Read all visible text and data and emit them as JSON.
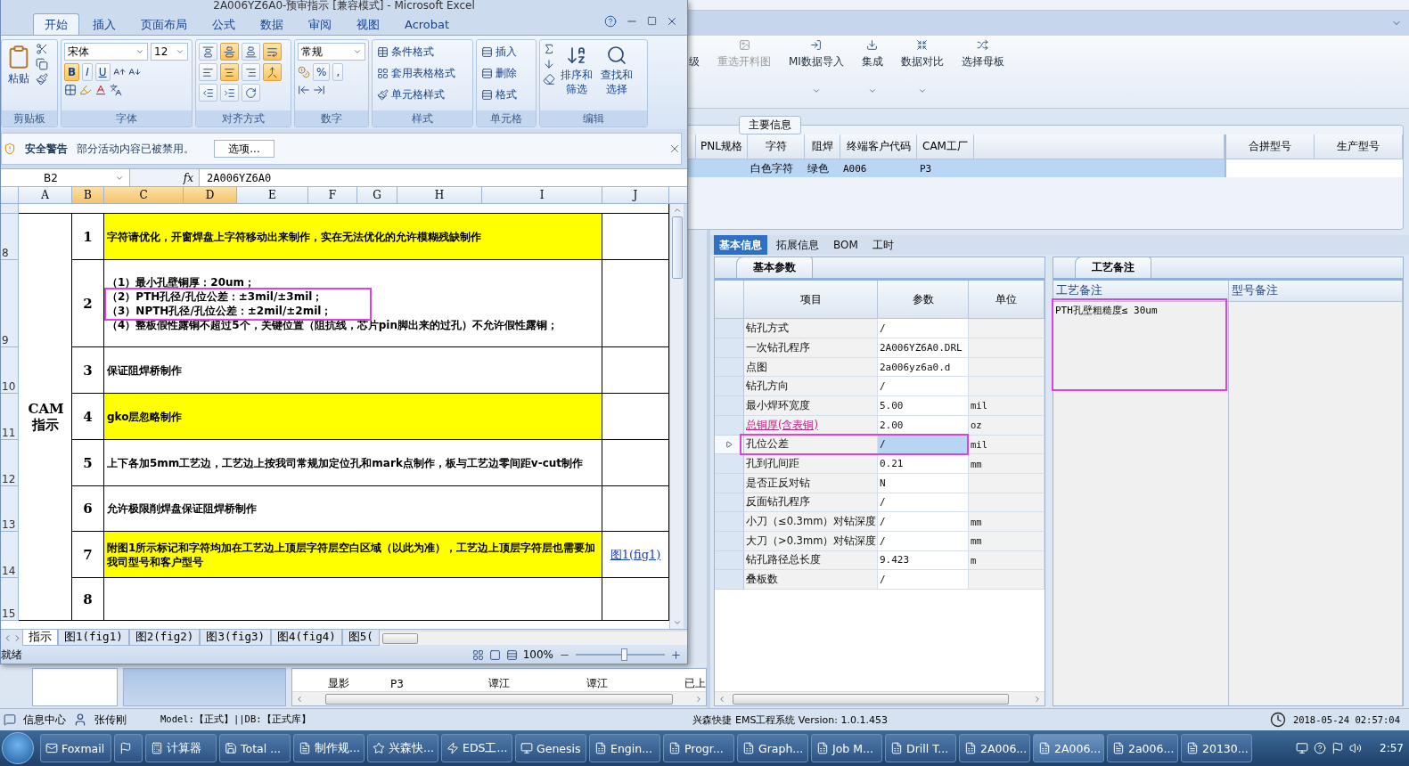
{
  "excel": {
    "title": "2A006YZ6A0-预审指示 [兼容模式] - Microsoft Excel",
    "tabs": [
      {
        "label": "开始",
        "selected": true
      },
      {
        "label": "插入",
        "selected": false
      },
      {
        "label": "页面布局",
        "selected": false
      },
      {
        "label": "公式",
        "selected": false
      },
      {
        "label": "数据",
        "selected": false
      },
      {
        "label": "审阅",
        "selected": false
      },
      {
        "label": "视图",
        "selected": false
      },
      {
        "label": "Acrobat",
        "selected": false
      }
    ],
    "ribbon": {
      "clipboard": {
        "title": "剪贴板",
        "paste": "粘贴"
      },
      "font": {
        "title": "字体",
        "face": "宋体",
        "size": "12",
        "styles": [
          {
            "label": "B",
            "selected": true
          },
          {
            "label": "I",
            "selected": false
          },
          {
            "label": "U",
            "selected": false
          }
        ]
      },
      "alignment": {
        "title": "对齐方式",
        "buttons": [
          {
            "selected": false
          },
          {
            "selected": true
          },
          {
            "selected": false
          },
          {
            "selected": true
          },
          {
            "selected": false
          },
          {
            "selected": true
          },
          {
            "selected": false
          },
          {
            "selected": true
          },
          {
            "selected": false
          },
          {
            "selected": false
          },
          {
            "selected": false
          }
        ]
      },
      "number": {
        "title": "数字",
        "format": "常规",
        "symbols": [
          "%",
          ","
        ]
      },
      "styles": {
        "title": "样式",
        "commands": [
          "条件格式",
          "套用表格格式",
          "单元格样式"
        ]
      },
      "cells": {
        "title": "单元格",
        "commands": [
          "插入",
          "删除",
          "格式"
        ]
      },
      "editing": {
        "title": "编辑",
        "commands": [
          "排序和筛选",
          "查找和选择"
        ]
      }
    },
    "security": {
      "title": "安全警告",
      "message": "部分活动内容已被禁用。",
      "button": "选项..."
    },
    "formula": {
      "cell": "B2",
      "fx": "fx",
      "value": "2A006YZ6A0"
    },
    "columns": [
      {
        "label": "A",
        "selected": false
      },
      {
        "label": "B",
        "selected": true
      },
      {
        "label": "C",
        "selected": true
      },
      {
        "label": "D",
        "selected": true
      },
      {
        "label": "E",
        "selected": false
      },
      {
        "label": "F",
        "selected": false
      },
      {
        "label": "G",
        "selected": false
      },
      {
        "label": "H",
        "selected": false
      },
      {
        "label": "I",
        "selected": false
      },
      {
        "label": "J",
        "selected": false
      }
    ],
    "category": "CAM 指示",
    "rows": [
      {
        "row_number": "8",
        "no": "1",
        "lines": [
          "字符请优化，开窗焊盘上字符移动出来制作，实在无法优化的允许模糊残缺制作"
        ],
        "highlighted": true,
        "annotated": false
      },
      {
        "row_number": "9",
        "no": "2",
        "lines": [
          "（1）最小孔壁铜厚：20um；",
          "（2）PTH孔径/孔位公差：±3mil/±3mil；",
          "（3）NPTH孔径/孔位公差：±2mil/±2mil；",
          "（4）整板假性露铜不超过5个，关键位置（阻抗线，芯片pin脚出来的过孔）不允许假性露铜；"
        ],
        "highlighted": false,
        "annotated": true
      },
      {
        "row_number": "10",
        "no": "3",
        "lines": [
          "保证阻焊桥制作"
        ],
        "highlighted": false,
        "annotated": false
      },
      {
        "row_number": "11",
        "no": "4",
        "lines": [
          "gko层忽略制作"
        ],
        "highlighted": true,
        "annotated": false
      },
      {
        "row_number": "12",
        "no": "5",
        "lines": [
          "上下各加5mm工艺边，工艺边上按我司常规加定位孔和mark点制作，板与工艺边零间距v-cut制作"
        ],
        "highlighted": false,
        "annotated": false
      },
      {
        "row_number": "13",
        "no": "6",
        "lines": [
          "允许极限削焊盘保证阻焊桥制作"
        ],
        "highlighted": false,
        "annotated": false
      },
      {
        "row_number": "14",
        "no": "7",
        "lines": [
          "附图1所示标记和字符均加在工艺边上顶层字符层空白区域（以此为准），工艺边上顶层字符层也需要加我司型号和客户型号"
        ],
        "link": "图1(fig1)",
        "highlighted": true,
        "annotated": false
      },
      {
        "row_number": "15",
        "no": "8",
        "lines": [],
        "highlighted": false,
        "annotated": false
      }
    ],
    "sheets": [
      {
        "label": "指示",
        "selected": true
      },
      {
        "label": "图1(fig1)",
        "selected": false
      },
      {
        "label": "图2(fig2)",
        "selected": false
      },
      {
        "label": "图3(fig3)",
        "selected": false
      },
      {
        "label": "图4(fig4)",
        "selected": false
      },
      {
        "label": "图5(",
        "selected": false
      }
    ],
    "status": "就绪",
    "zoom": "100%",
    "zoom_slider": {
      "level": 0.55
    }
  },
  "ems": {
    "toolbar": [
      {
        "label": "级",
        "disabled": false,
        "dropdown": false
      },
      {
        "label": "重选开料图",
        "disabled": true,
        "dropdown": false
      },
      {
        "label": "MI数据导入",
        "disabled": false,
        "dropdown": true
      },
      {
        "label": "集成",
        "disabled": false,
        "dropdown": true
      },
      {
        "label": "数据对比",
        "disabled": false,
        "dropdown": true
      },
      {
        "label": "选择母板",
        "disabled": false,
        "dropdown": false
      }
    ],
    "main_info": {
      "title": "主要信息",
      "columns": [
        "PNL规格",
        "字符",
        "阻焊",
        "终端客户代码",
        "CAM工厂"
      ],
      "rows": [
        {
          "cells": [
            "",
            "白色字符",
            "绿色",
            "A006",
            "P3"
          ],
          "selected": true
        }
      ],
      "side_columns": [
        "合拼型号",
        "生产型号"
      ]
    },
    "tabs": [
      {
        "label": "基本信息",
        "selected": true
      },
      {
        "label": "拓展信息",
        "selected": false
      },
      {
        "label": "BOM",
        "selected": false
      },
      {
        "label": "工时",
        "selected": false
      }
    ],
    "params": {
      "title": "基本参数",
      "columns": [
        "项目",
        "参数",
        "单位"
      ],
      "rows": [
        {
          "item": "钻孔方式",
          "value": "/",
          "unit": "",
          "selected": false,
          "flagged": false,
          "annotated": false
        },
        {
          "item": "一次钻孔程序",
          "value": "2A006YZ6A0.DRL",
          "unit": "",
          "selected": false,
          "flagged": false,
          "annotated": false
        },
        {
          "item": "点图",
          "value": "2a006yz6a0.d",
          "unit": "",
          "selected": false,
          "flagged": false,
          "annotated": false
        },
        {
          "item": "钻孔方向",
          "value": "/",
          "unit": "",
          "selected": false,
          "flagged": false,
          "annotated": false
        },
        {
          "item": "最小焊环宽度",
          "value": "5.00",
          "unit": "mil",
          "selected": false,
          "flagged": false,
          "annotated": false
        },
        {
          "item": "总铜厚(含表铜)",
          "value": "2.00",
          "unit": "oz",
          "selected": false,
          "flagged": true,
          "annotated": false
        },
        {
          "item": "孔位公差",
          "value": "/",
          "unit": "mil",
          "selected": true,
          "flagged": false,
          "annotated": true
        },
        {
          "item": "孔到孔间距",
          "value": "0.21",
          "unit": "mm",
          "selected": false,
          "flagged": false,
          "annotated": false
        },
        {
          "item": "是否正反对钻",
          "value": "N",
          "unit": "",
          "selected": false,
          "flagged": false,
          "annotated": false
        },
        {
          "item": "反面钻孔程序",
          "value": "/",
          "unit": "",
          "selected": false,
          "flagged": false,
          "annotated": false
        },
        {
          "item": "小刀（≤0.3mm）对钻深度",
          "value": "/",
          "unit": "mm",
          "selected": false,
          "flagged": false,
          "annotated": false
        },
        {
          "item": "大刀（>0.3mm）对钻深度",
          "value": "/",
          "unit": "mm",
          "selected": false,
          "flagged": false,
          "annotated": false
        },
        {
          "item": "钻孔路径总长度",
          "value": "9.423",
          "unit": "m",
          "selected": false,
          "flagged": false,
          "annotated": false
        },
        {
          "item": "叠板数",
          "value": "/",
          "unit": "",
          "selected": false,
          "flagged": false,
          "annotated": false
        }
      ]
    },
    "remarks": {
      "title": "工艺备注",
      "columns": [
        "工艺备注",
        "型号备注"
      ],
      "note": "PTH孔壁粗糙度≤ 30um",
      "annotated": true
    },
    "tree_rows": [
      {
        "name": "显影",
        "cells": [
          "P3",
          "谭江",
          "谭江",
          "已上"
        ]
      }
    ],
    "status": {
      "info": "信息中心",
      "user": "张传刚",
      "model": "Model:【正式】||DB:【正式库】",
      "product": "兴森快捷 EMS工程系统 Version: 1.0.1.453",
      "datetime": "2018-05-24 02:57:04"
    }
  },
  "taskbar": {
    "items": [
      {
        "kind": "app",
        "label": "Foxmail",
        "selected": false
      },
      {
        "kind": "icon",
        "selected": false
      },
      {
        "kind": "app",
        "label": "计算器",
        "selected": false
      },
      {
        "kind": "app",
        "label": "Total ...",
        "selected": false
      },
      {
        "kind": "app",
        "label": "制作规...",
        "selected": false
      },
      {
        "kind": "app",
        "label": "兴森快...",
        "selected": false
      },
      {
        "kind": "app",
        "label": "EDS工...",
        "selected": false
      },
      {
        "kind": "app",
        "label": "Genesis",
        "selected": false
      },
      {
        "kind": "app",
        "label": "Engin...",
        "selected": false
      },
      {
        "kind": "app",
        "label": "Progr...",
        "selected": false
      },
      {
        "kind": "app",
        "label": "Graph...",
        "selected": false
      },
      {
        "kind": "app",
        "label": "Job M...",
        "selected": false
      },
      {
        "kind": "app",
        "label": "Drill T...",
        "selected": false
      },
      {
        "kind": "app",
        "label": "2A006...",
        "selected": false
      },
      {
        "kind": "app",
        "label": "2A006...",
        "selected": true
      },
      {
        "kind": "app",
        "label": "2a006...",
        "selected": false
      },
      {
        "kind": "app",
        "label": "20130...",
        "selected": false
      }
    ],
    "time": "2:57"
  }
}
